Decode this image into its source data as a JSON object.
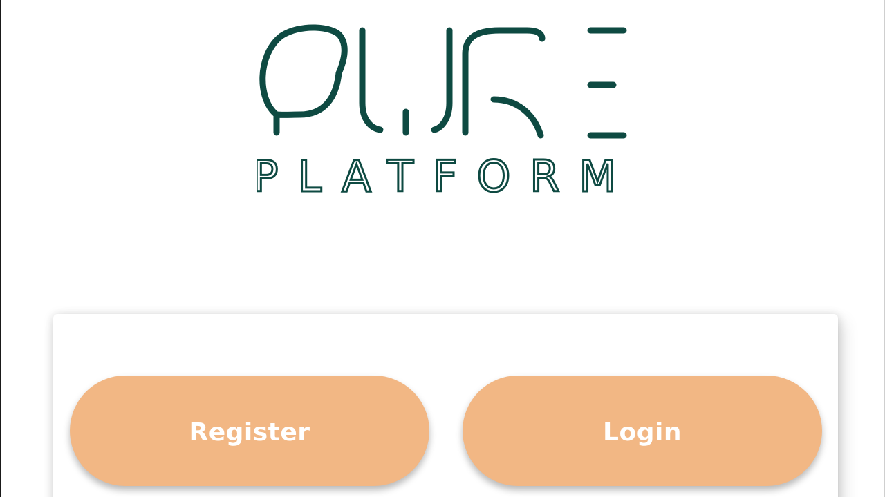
{
  "brand": {
    "wordmark": "PURE",
    "tagline": "PLATFORM",
    "color": "#0e4a42"
  },
  "actions": {
    "register_label": "Register",
    "login_label": "Login",
    "button_color": "#f2b784"
  }
}
